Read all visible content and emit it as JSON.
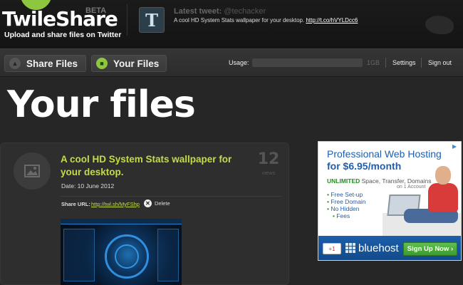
{
  "app": {
    "name": "TwileShare",
    "badge": "BETA",
    "tagline": "Upload and share files on Twitter"
  },
  "tweet": {
    "title": "Latest tweet:",
    "handle": "@techacker",
    "text": "A cool HD System Stats wallpaper for your desktop.",
    "link": "http://t.co/hVYLDcc6"
  },
  "nav": {
    "share_label": "Share Files",
    "your_label": "Your Files",
    "usage_label": "Usage:",
    "usage_max": "1GB",
    "usage_fraction": 0.0,
    "settings_label": "Settings",
    "signout_label": "Sign out"
  },
  "page": {
    "title": "Your files"
  },
  "file": {
    "title": "A cool HD System Stats wallpaper for your desktop.",
    "date": "Date: 10 June 2012",
    "views_count": "12",
    "views_label": "views",
    "share_url_label": "Share URL:",
    "share_url": "http://twl.sh/MyFShp",
    "delete_label": "Delete"
  },
  "ad": {
    "headline_line1": "Professional Web Hosting",
    "headline_line2": "for $6.95/month",
    "unlimited_bold": "UNLIMITED",
    "unlimited_rest": " Space, Transfer, Domains",
    "account_note": "on 1 Account",
    "features": [
      "Free Set-up",
      "Free Domain",
      "No Hidden",
      "Fees"
    ],
    "gplus": "+1",
    "brand": "bluehost",
    "cta": "Sign Up Now ›"
  },
  "colors": {
    "accent_green": "#c3dd45",
    "logo_green": "#8dc63f",
    "ad_blue": "#1f5fae"
  }
}
